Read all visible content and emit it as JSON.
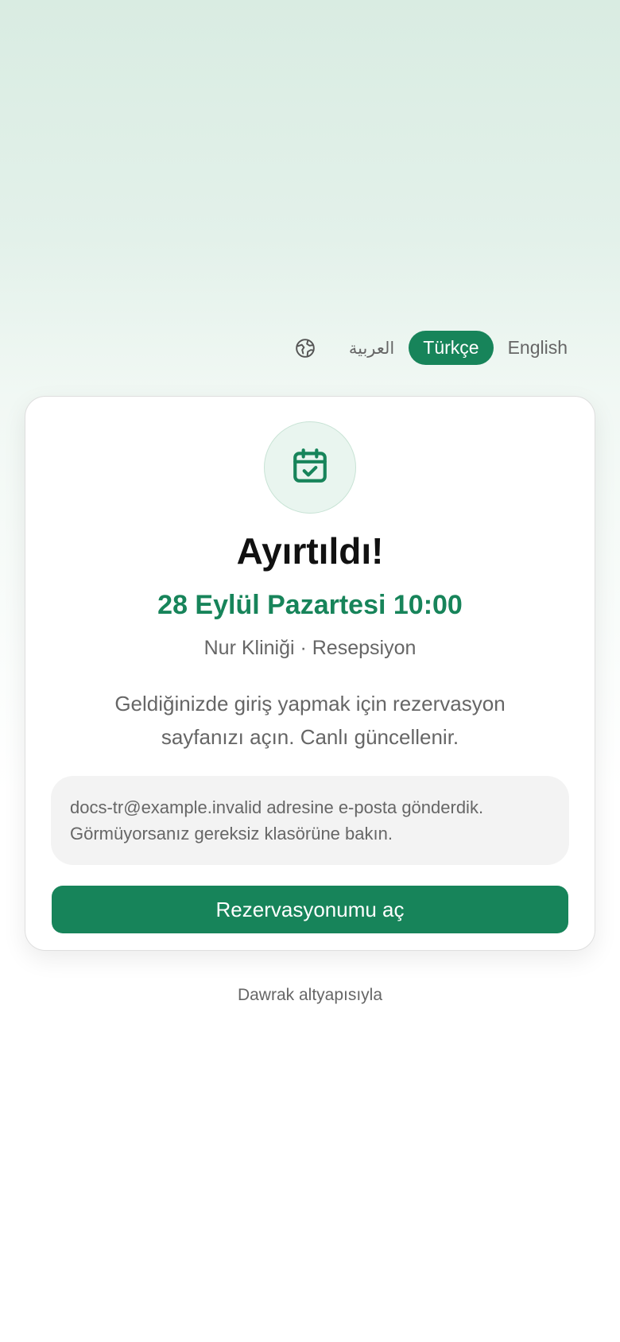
{
  "language_switcher": {
    "options": [
      {
        "label": "العربية",
        "active": false
      },
      {
        "label": "Türkçe",
        "active": true
      },
      {
        "label": "English",
        "active": false
      }
    ]
  },
  "confirmation": {
    "icon": "calendar-check-icon",
    "title": "Ayırtıldı!",
    "datetime": "28 Eylül Pazartesi 10:00",
    "location": "Nur Kliniği · Resepsiyon",
    "description": "Geldiğinizde giriş yapmak için rezervasyon sayfanızı açın. Canlı güncellenir.",
    "email_notice": "docs-tr@example.invalid adresine e-posta gönderdik. Görmüyorsanız gereksiz klasörüne bakın.",
    "cta_label": "Rezervasyonumu aç"
  },
  "footer": {
    "text": "Dawrak altyapısıyla"
  },
  "colors": {
    "accent": "#17845a",
    "accent_light": "#e9f5ef"
  }
}
